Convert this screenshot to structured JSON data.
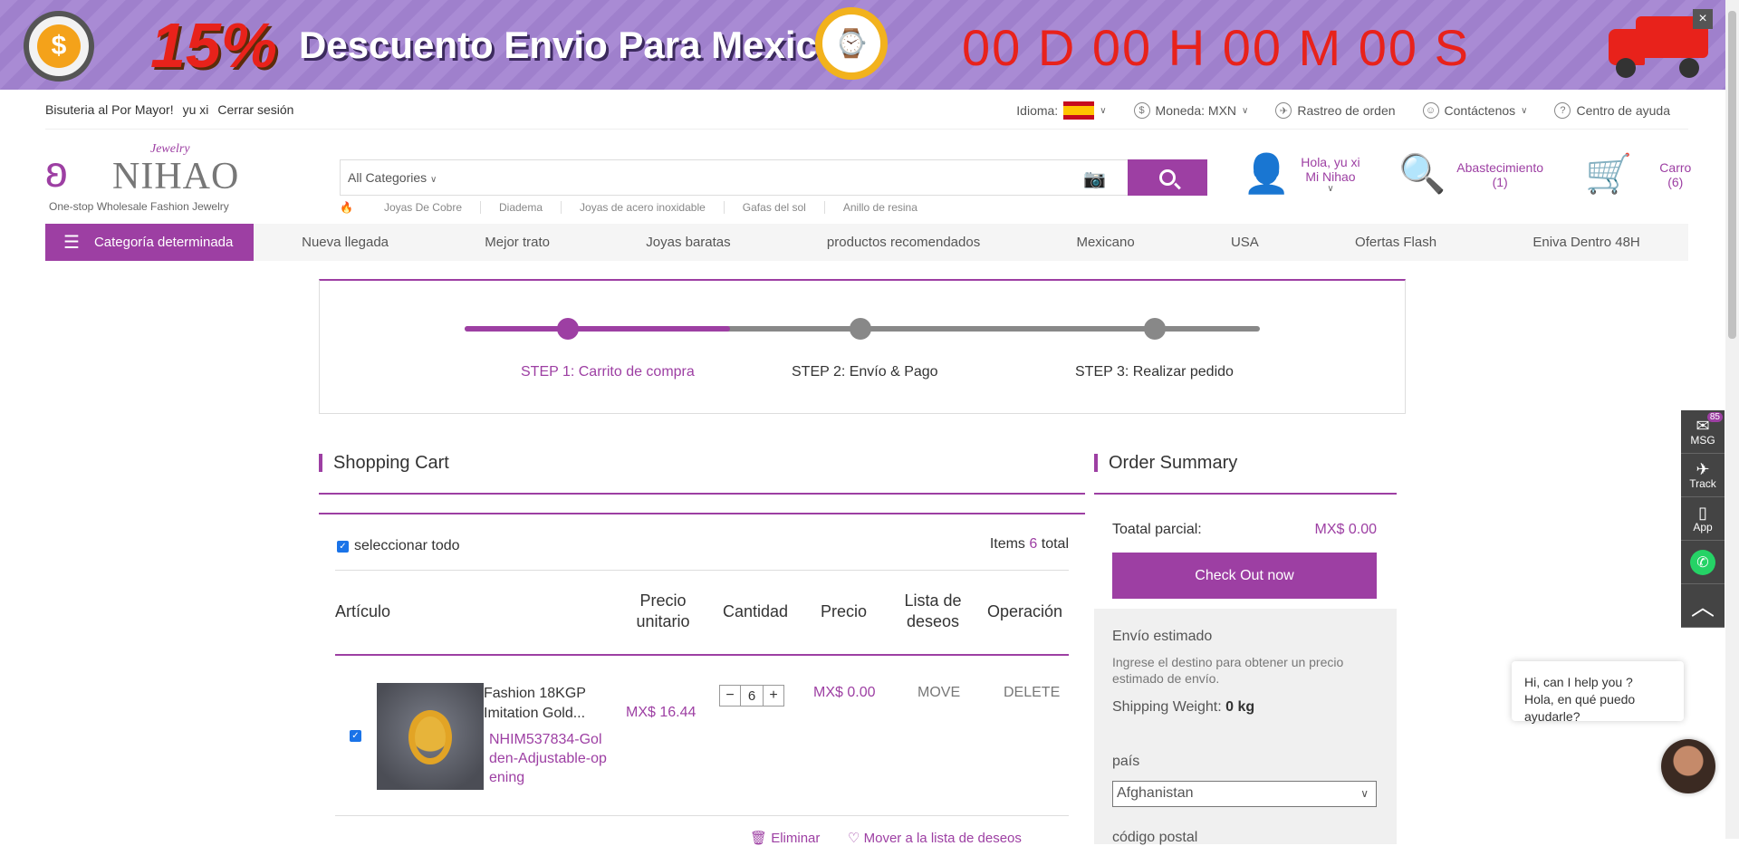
{
  "banner": {
    "percent": "15%",
    "text": "Descuento Envio Para Mexico",
    "countdown": "00 D 00 H 00 M 00 S",
    "close": "×"
  },
  "topbar": {
    "site": "Bisuteria al Por Mayor!",
    "user": "yu xi",
    "logout": "Cerrar sesión",
    "language_label": "Idioma:",
    "currency": "Moneda: MXN",
    "tracking": "Rastreo de orden",
    "contact": "Contáctenos",
    "help": "Centro de ayuda"
  },
  "logo": {
    "jewelry": "Jewelry",
    "name": "NIHAO",
    "tagline": "One-stop Wholesale Fashion Jewelry"
  },
  "search": {
    "category": "All Categories",
    "placeholder": "",
    "keywords": [
      "Joyas De Cobre",
      "Diadema",
      "Joyas de acero inoxidable",
      "Gafas del sol",
      "Anillo de resina"
    ]
  },
  "header": {
    "greeting": "Hola, yu xi",
    "account": "Mi Nihao",
    "sourcing": "Abastecimiento",
    "sourcing_count": "(1)",
    "cart": "Carro",
    "cart_count": "(6)"
  },
  "nav": {
    "category": "Categoría determinada",
    "items": [
      "Nueva llegada",
      "Mejor trato",
      "Joyas baratas",
      "productos recomendados",
      "Mexicano",
      "USA",
      "Ofertas Flash",
      "Eniva Dentro 48H"
    ]
  },
  "steps": {
    "s1": "STEP 1: Carrito de compra",
    "s2": "STEP 2: Envío & Pago",
    "s3": "STEP 3: Realizar pedido",
    "progress": 0.333
  },
  "cart": {
    "title": "Shopping Cart",
    "select_all": "seleccionar todo",
    "items_prefix": "Items",
    "items_count": "6",
    "items_suffix": "total",
    "columns": [
      "Artículo",
      "Precio unitario",
      "Cantidad",
      "Precio",
      "Lista de deseos",
      "Operación"
    ],
    "rows": [
      {
        "name": "Fashion 18KGP Imitation Gold...",
        "sku": "NHIM537834-Golden-Adjustable-opening",
        "unit_price": "MX$ 16.44",
        "quantity": "6",
        "price": "MX$ 0.00",
        "move": "MOVE",
        "delete": "DELETE"
      }
    ],
    "footer_delete": "Eliminar",
    "footer_wishlist": "Mover a la lista de deseos"
  },
  "summary": {
    "title": "Order Summary",
    "subtotal_label": "Toatal parcial:",
    "subtotal_value": "MX$ 0.00",
    "checkout": "Check Out now",
    "est_title": "Envío estimado",
    "est_desc": "Ingrese el destino para obtener un precio estimado de envío.",
    "weight_label": "Shipping Weight:",
    "weight_value": "0 kg",
    "country_label": "país",
    "country_value": "Afghanistan",
    "postal_label": "código postal"
  },
  "sidebar": {
    "msg": "MSG",
    "msg_badge": "85",
    "track": "Track",
    "app": "App"
  },
  "chat": {
    "line1": "Hi, can I help you ?",
    "line2": "Hola, en qué puedo ayudarle?"
  },
  "colors": {
    "accent": "#9d3fa3",
    "banner": "#a98bd4",
    "countdown": "#e8221b"
  }
}
